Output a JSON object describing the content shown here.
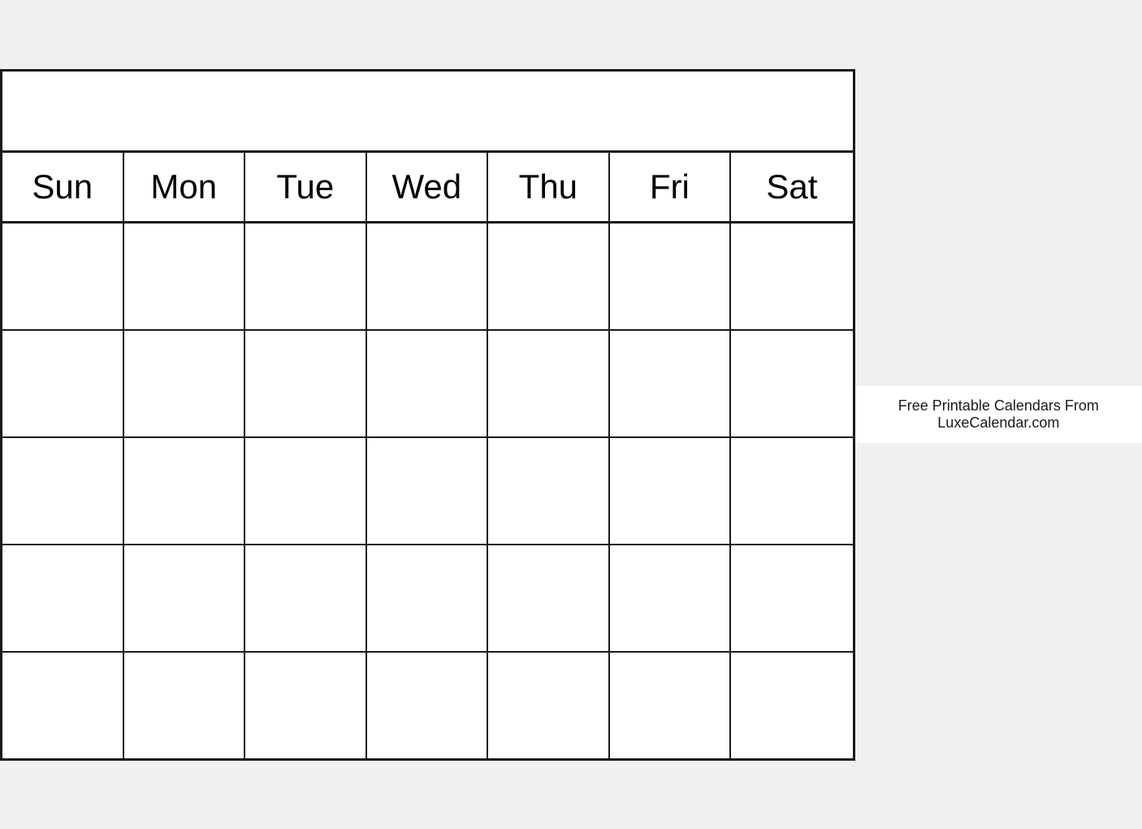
{
  "calendar": {
    "days": [
      "Sun",
      "Mon",
      "Tue",
      "Wed",
      "Thu",
      "Fri",
      "Sat"
    ],
    "rows": 5,
    "footer_text": "Free Printable Calendars From LuxeCalendar.com"
  }
}
